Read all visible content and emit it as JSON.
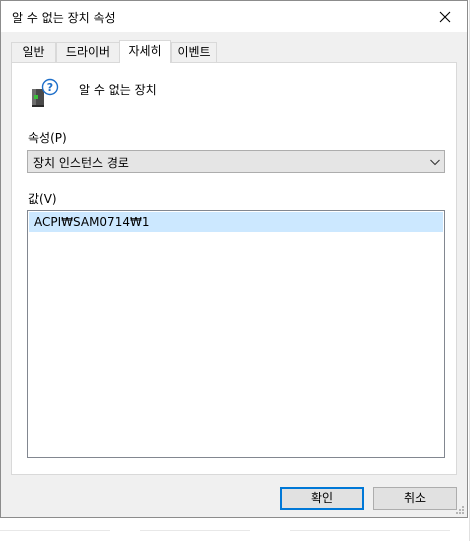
{
  "window": {
    "title": "알 수 없는 장치 속성",
    "close_icon": "close-icon"
  },
  "tabs": [
    {
      "label": "일반",
      "active": false
    },
    {
      "label": "드라이버",
      "active": false
    },
    {
      "label": "자세히",
      "active": true
    },
    {
      "label": "이벤트",
      "active": false
    }
  ],
  "device": {
    "icon": "unknown-device-icon",
    "name": "알 수 없는 장치"
  },
  "property": {
    "label": "속성(P)",
    "selected": "장치 인스턴스 경로"
  },
  "value": {
    "label": "값(V)",
    "items": [
      "ACPI₩SAM0714₩1"
    ]
  },
  "buttons": {
    "ok": "확인",
    "cancel": "취소"
  },
  "colors": {
    "selection": "#cce8ff",
    "default_button_border": "#0078d7",
    "dialog_bg": "#f0f0f0"
  }
}
